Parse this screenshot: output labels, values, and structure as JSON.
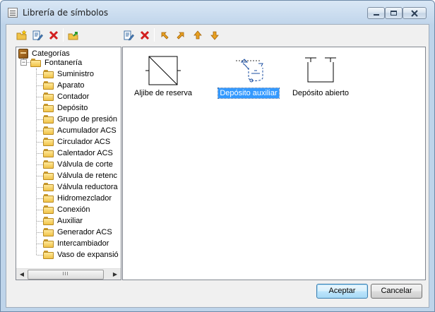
{
  "window": {
    "title": "Librería de símbolos"
  },
  "toolbar": {
    "left_group": [
      "new-folder-icon",
      "edit-folder-icon",
      "delete-icon",
      "import-icon"
    ],
    "right_group": [
      "edit-symbol-icon",
      "delete-symbol-icon",
      "move-up-left-icon",
      "move-up-right-icon",
      "move-up-icon",
      "move-down-icon"
    ],
    "colors": {
      "delete": "#d21f1f",
      "arrows": "#e8a020",
      "folder": "#f0c348"
    }
  },
  "tree": {
    "root": "Categorías",
    "group": "Fontanería",
    "items": [
      "Suministro",
      "Aparato",
      "Contador",
      "Depósito",
      "Grupo de presión",
      "Acumulador ACS",
      "Circulador ACS",
      "Calentador ACS",
      "Válvula de corte",
      "Válvula de retenc",
      "Válvula reductora",
      "Hidromezclador",
      "Conexión",
      "Auxiliar",
      "Generador ACS",
      "Intercambiador",
      "Vaso de expansió"
    ],
    "selected_index": 3,
    "scroll_thumb": "III"
  },
  "symbols": {
    "items": [
      {
        "label": "Aljibe de reserva",
        "selected": false
      },
      {
        "label": "Depósito auxiliar",
        "selected": true
      },
      {
        "label": "Depósito abierto",
        "selected": false
      }
    ],
    "selection_color": "#3399ff"
  },
  "buttons": {
    "accept": "Aceptar",
    "cancel": "Cancelar"
  }
}
